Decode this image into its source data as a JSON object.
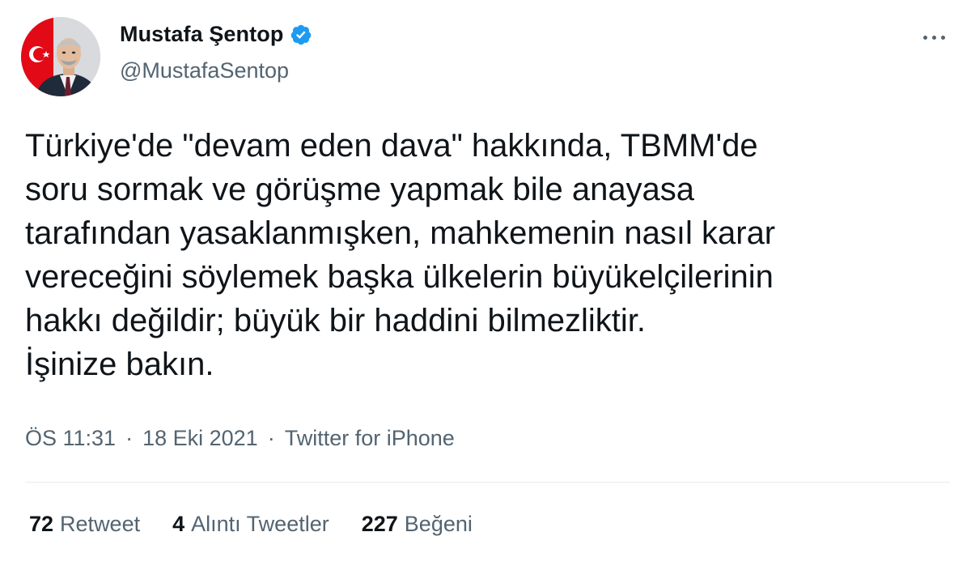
{
  "author": {
    "name": "Mustafa Şentop",
    "handle": "@MustafaSentop",
    "verified": true,
    "verified_color": "#1d9bf0"
  },
  "tweet": {
    "text": "Türkiye'de \"devam eden dava\" hakkında, TBMM'de\nsoru sormak ve görüşme yapmak bile anayasa\ntarafından yasaklanmışken, mahkemenin nasıl karar\nvereceğini söylemek başka ülkelerin büyükelçilerinin\nhakkı değildir; büyük bir haddini bilmezliktir.\nİşinize bakın."
  },
  "meta": {
    "time": "ÖS 11:31",
    "date": "18 Eki 2021",
    "separator": "·",
    "source": "Twitter for iPhone"
  },
  "stats": {
    "retweets": {
      "count": "72",
      "label": "Retweet"
    },
    "quotes": {
      "count": "4",
      "label": "Alıntı Tweetler"
    },
    "likes": {
      "count": "227",
      "label": "Beğeni"
    }
  },
  "icons": {
    "more": "more-options-icon",
    "verified": "verified-badge-icon"
  },
  "colors": {
    "text_primary": "#0f1419",
    "text_secondary": "#536471",
    "divider": "#e6ecf0",
    "flag_red": "#e30a17"
  }
}
